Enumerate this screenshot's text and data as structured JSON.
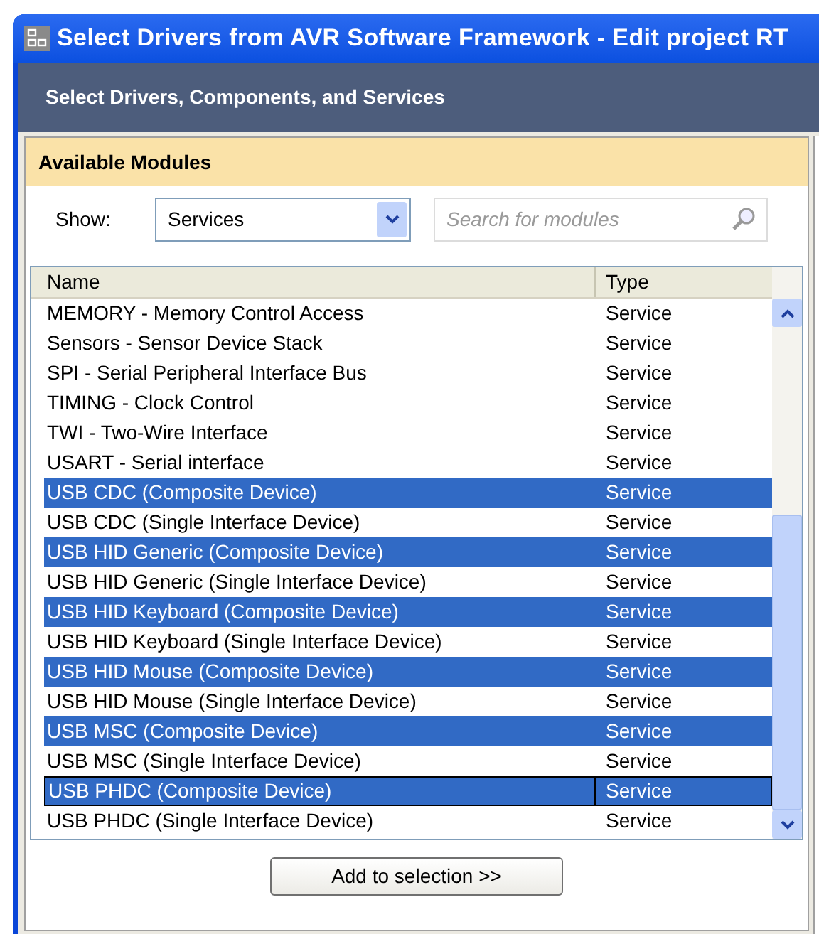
{
  "window": {
    "title": "Select Drivers from AVR Software Framework - Edit project RT"
  },
  "header": {
    "title": "Select Drivers, Components, and Services"
  },
  "panel": {
    "title": "Available Modules"
  },
  "filter": {
    "label": "Show:",
    "value": "Services"
  },
  "search": {
    "placeholder": "Search for modules"
  },
  "table": {
    "columns": [
      "Name",
      "Type"
    ],
    "rows": [
      {
        "name": "MEMORY - Memory Control Access",
        "type": "Service",
        "selected": false,
        "focused": false
      },
      {
        "name": "Sensors - Sensor Device Stack",
        "type": "Service",
        "selected": false,
        "focused": false
      },
      {
        "name": "SPI - Serial Peripheral Interface Bus",
        "type": "Service",
        "selected": false,
        "focused": false
      },
      {
        "name": "TIMING - Clock Control",
        "type": "Service",
        "selected": false,
        "focused": false
      },
      {
        "name": "TWI - Two-Wire Interface",
        "type": "Service",
        "selected": false,
        "focused": false
      },
      {
        "name": "USART - Serial interface",
        "type": "Service",
        "selected": false,
        "focused": false
      },
      {
        "name": "USB CDC (Composite Device)",
        "type": "Service",
        "selected": true,
        "focused": false
      },
      {
        "name": "USB CDC (Single Interface Device)",
        "type": "Service",
        "selected": false,
        "focused": false
      },
      {
        "name": "USB HID Generic (Composite Device)",
        "type": "Service",
        "selected": true,
        "focused": false
      },
      {
        "name": "USB HID Generic (Single Interface Device)",
        "type": "Service",
        "selected": false,
        "focused": false
      },
      {
        "name": "USB HID Keyboard (Composite Device)",
        "type": "Service",
        "selected": true,
        "focused": false
      },
      {
        "name": "USB HID Keyboard (Single Interface Device)",
        "type": "Service",
        "selected": false,
        "focused": false
      },
      {
        "name": "USB HID Mouse (Composite Device)",
        "type": "Service",
        "selected": true,
        "focused": false
      },
      {
        "name": "USB HID Mouse (Single Interface Device)",
        "type": "Service",
        "selected": false,
        "focused": false
      },
      {
        "name": "USB MSC (Composite Device)",
        "type": "Service",
        "selected": true,
        "focused": false
      },
      {
        "name": "USB MSC (Single Interface Device)",
        "type": "Service",
        "selected": false,
        "focused": false
      },
      {
        "name": "USB PHDC (Composite Device)",
        "type": "Service",
        "selected": true,
        "focused": true
      },
      {
        "name": "USB PHDC (Single Interface Device)",
        "type": "Service",
        "selected": false,
        "focused": false
      }
    ]
  },
  "add_button": {
    "label": "Add to selection >>"
  }
}
